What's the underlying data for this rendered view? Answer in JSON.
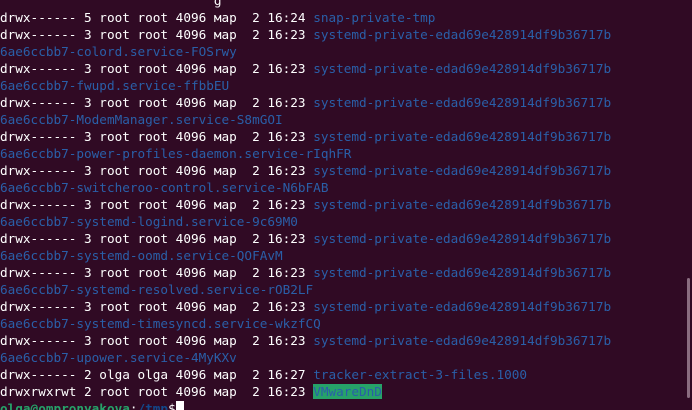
{
  "terminal": {
    "theme": {
      "background": "#300a24",
      "foreground": "#ffffff",
      "directory_color": "#2a5fa8",
      "sticky_highlight": "#26a269",
      "prompt_user_color": "#26a269"
    },
    "partial_top_line": "                            g",
    "entries": [
      {
        "perms": "drwx------",
        "links": "5",
        "owner": "root",
        "group": "root",
        "size": "4096",
        "month": "мар",
        "day": "2",
        "time": "16:24",
        "name": "snap-private-tmp",
        "wrap": ""
      },
      {
        "perms": "drwx------",
        "links": "3",
        "owner": "root",
        "group": "root",
        "size": "4096",
        "month": "мар",
        "day": "2",
        "time": "16:23",
        "name": "systemd-private-edad69e428914df9b36717b",
        "wrap": "6ae6ccbb7-colord.service-FOSrwy"
      },
      {
        "perms": "drwx------",
        "links": "3",
        "owner": "root",
        "group": "root",
        "size": "4096",
        "month": "мар",
        "day": "2",
        "time": "16:23",
        "name": "systemd-private-edad69e428914df9b36717b",
        "wrap": "6ae6ccbb7-fwupd.service-ffbbEU"
      },
      {
        "perms": "drwx------",
        "links": "3",
        "owner": "root",
        "group": "root",
        "size": "4096",
        "month": "мар",
        "day": "2",
        "time": "16:23",
        "name": "systemd-private-edad69e428914df9b36717b",
        "wrap": "6ae6ccbb7-ModemManager.service-S8mGOI"
      },
      {
        "perms": "drwx------",
        "links": "3",
        "owner": "root",
        "group": "root",
        "size": "4096",
        "month": "мар",
        "day": "2",
        "time": "16:23",
        "name": "systemd-private-edad69e428914df9b36717b",
        "wrap": "6ae6ccbb7-power-profiles-daemon.service-rIqhFR"
      },
      {
        "perms": "drwx------",
        "links": "3",
        "owner": "root",
        "group": "root",
        "size": "4096",
        "month": "мар",
        "day": "2",
        "time": "16:23",
        "name": "systemd-private-edad69e428914df9b36717b",
        "wrap": "6ae6ccbb7-switcheroo-control.service-N6bFAB"
      },
      {
        "perms": "drwx------",
        "links": "3",
        "owner": "root",
        "group": "root",
        "size": "4096",
        "month": "мар",
        "day": "2",
        "time": "16:23",
        "name": "systemd-private-edad69e428914df9b36717b",
        "wrap": "6ae6ccbb7-systemd-logind.service-9c69M0"
      },
      {
        "perms": "drwx------",
        "links": "3",
        "owner": "root",
        "group": "root",
        "size": "4096",
        "month": "мар",
        "day": "2",
        "time": "16:23",
        "name": "systemd-private-edad69e428914df9b36717b",
        "wrap": "6ae6ccbb7-systemd-oomd.service-QOFAvM"
      },
      {
        "perms": "drwx------",
        "links": "3",
        "owner": "root",
        "group": "root",
        "size": "4096",
        "month": "мар",
        "day": "2",
        "time": "16:23",
        "name": "systemd-private-edad69e428914df9b36717b",
        "wrap": "6ae6ccbb7-systemd-resolved.service-rOB2LF"
      },
      {
        "perms": "drwx------",
        "links": "3",
        "owner": "root",
        "group": "root",
        "size": "4096",
        "month": "мар",
        "day": "2",
        "time": "16:23",
        "name": "systemd-private-edad69e428914df9b36717b",
        "wrap": "6ae6ccbb7-systemd-timesyncd.service-wkzfCQ"
      },
      {
        "perms": "drwx------",
        "links": "3",
        "owner": "root",
        "group": "root",
        "size": "4096",
        "month": "мар",
        "day": "2",
        "time": "16:23",
        "name": "systemd-private-edad69e428914df9b36717b",
        "wrap": "6ae6ccbb7-upower.service-4MyKXv"
      },
      {
        "perms": "drwx------",
        "links": "2",
        "owner": "olga",
        "group": "olga",
        "size": "4096",
        "month": "мар",
        "day": "2",
        "time": "16:27",
        "name": "tracker-extract-3-files.1000",
        "wrap": ""
      },
      {
        "perms": "drwxrwxrwt",
        "links": "2",
        "owner": "root",
        "group": "root",
        "size": "4096",
        "month": "мар",
        "day": "2",
        "time": "16:23",
        "name": "VMwareDnD",
        "wrap": "",
        "highlight": true
      }
    ],
    "prompt": {
      "user_host": "olga@ompronyakova",
      "separator": ":",
      "path": "/tmp",
      "symbol": "$"
    }
  }
}
